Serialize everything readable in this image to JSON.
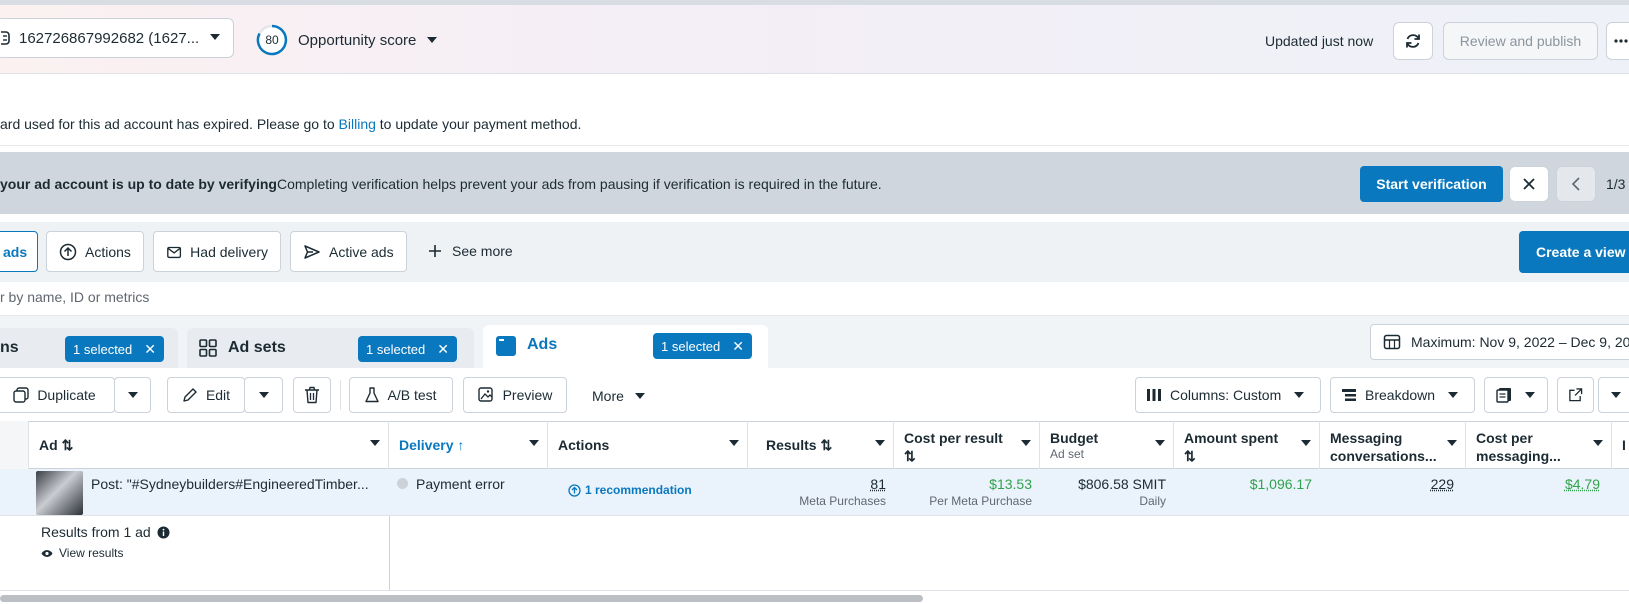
{
  "topbar": {
    "account_label": "162726867992682 (1627...",
    "score_value": "80",
    "score_label": "Opportunity score",
    "updated_text": "Updated just now",
    "review_label": "Review and publish"
  },
  "billing_banner": {
    "text_before": "ard used for this ad account has expired. Please go to ",
    "link": "Billing",
    "text_after": " to update your payment method."
  },
  "verify_banner": {
    "bold_text": "your ad account is up to date by verifying",
    "description": "Completing verification helps prevent your ads from pausing if verification is required in the future.",
    "start_button": "Start verification",
    "pager": "1/3"
  },
  "filters": {
    "chips": [
      "ads",
      "Actions",
      "Had delivery",
      "Active ads"
    ],
    "see_more": "See more",
    "create_view": "Create a view"
  },
  "search": {
    "placeholder": "r by name, ID or metrics"
  },
  "levels": {
    "campaigns": {
      "label": "ns",
      "selected": "1 selected"
    },
    "adsets": {
      "label": "Ad sets",
      "selected": "1 selected"
    },
    "ads": {
      "label": "Ads",
      "selected": "1 selected"
    },
    "date_range": "Maximum: Nov 9, 2022 – Dec 9, 20"
  },
  "toolbar": {
    "duplicate": "Duplicate",
    "edit": "Edit",
    "ab_test": "A/B test",
    "preview": "Preview",
    "more": "More",
    "columns": "Columns: Custom",
    "breakdown": "Breakdown"
  },
  "table": {
    "headers": {
      "ad": "Ad",
      "delivery": "Delivery",
      "actions": "Actions",
      "results": "Results",
      "cost_per_result": "Cost per result",
      "budget": "Budget",
      "budget_sub": "Ad set",
      "amount_spent": "Amount spent",
      "messaging": "Messaging conversations...",
      "cost_per_messaging": "Cost per messaging...",
      "extra": "I"
    },
    "row": {
      "name": "Post: \"#Sydneybuilders#EngineeredTimber...",
      "delivery": "Payment error",
      "actions": "1 recommendation",
      "results": "81",
      "results_sub": "Meta Purchases",
      "cost_per_result": "$13.53",
      "cost_per_result_sub": "Per Meta Purchase",
      "budget": "$806.58 SMIT",
      "budget_sub": "Daily",
      "amount_spent": "$1,096.17",
      "messaging": "229",
      "cost_per_messaging": "$4.79"
    },
    "summary": {
      "title": "Results from 1 ad",
      "view": "View results"
    }
  },
  "colors": {
    "accent": "#0a78be",
    "positive": "#31a24c",
    "banner": "#cfd6dd"
  }
}
